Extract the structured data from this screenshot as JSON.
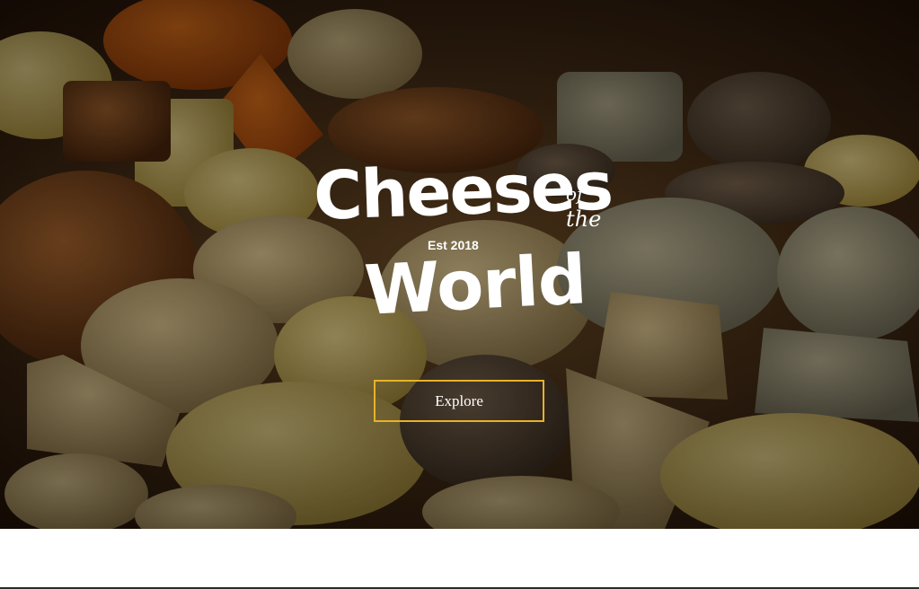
{
  "hero": {
    "background": "photo of assorted cheeses",
    "overlay_color": "#000000",
    "logo": {
      "line1": "Cheeses",
      "of": "of",
      "the": "the",
      "established": "Est 2018",
      "line2": "World"
    },
    "explore_button": {
      "label": "Explore",
      "border_color": "#e7b22b"
    }
  }
}
